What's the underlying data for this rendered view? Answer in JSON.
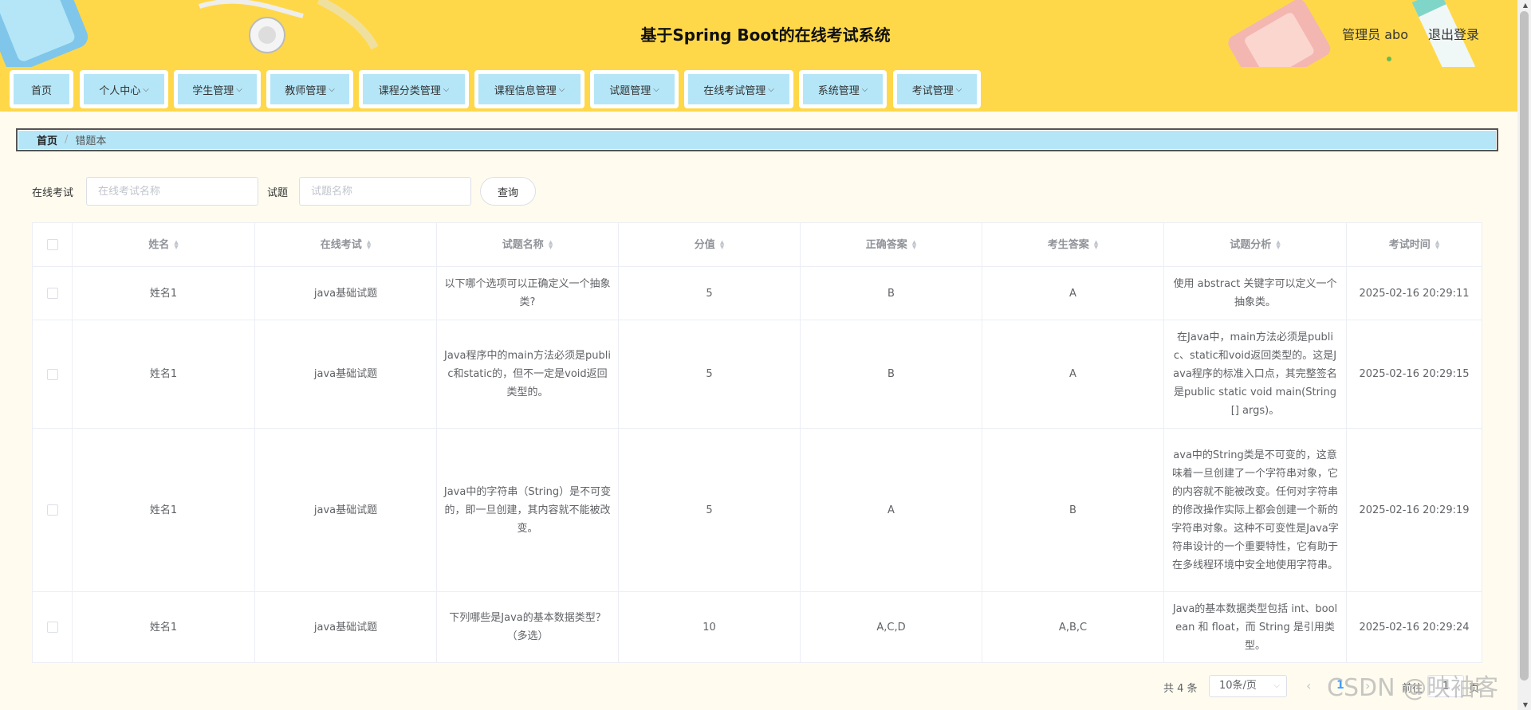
{
  "header": {
    "title": "基于Spring Boot的在线考试系统",
    "user": "管理员 abo",
    "logout": "退出登录"
  },
  "nav": {
    "items": [
      {
        "label": "首页",
        "dropdown": false
      },
      {
        "label": "个人中心",
        "dropdown": true
      },
      {
        "label": "学生管理",
        "dropdown": true
      },
      {
        "label": "教师管理",
        "dropdown": true
      },
      {
        "label": "课程分类管理",
        "dropdown": true
      },
      {
        "label": "课程信息管理",
        "dropdown": true
      },
      {
        "label": "试题管理",
        "dropdown": true
      },
      {
        "label": "在线考试管理",
        "dropdown": true
      },
      {
        "label": "系统管理",
        "dropdown": true
      },
      {
        "label": "考试管理",
        "dropdown": true
      }
    ]
  },
  "breadcrumb": {
    "home": "首页",
    "separator": "/",
    "current": "错题本"
  },
  "search": {
    "exam_label": "在线考试",
    "exam_placeholder": "在线考试名称",
    "question_label": "试题",
    "question_placeholder": "试题名称",
    "button": "查询"
  },
  "table": {
    "columns": [
      "姓名",
      "在线考试",
      "试题名称",
      "分值",
      "正确答案",
      "考生答案",
      "试题分析",
      "考试时间"
    ],
    "rows": [
      {
        "name": "姓名1",
        "exam": "java基础试题",
        "question": "以下哪个选项可以正确定义一个抽象类?",
        "score": "5",
        "correct": "B",
        "answer": "A",
        "analysis": "使用 abstract 关键字可以定义一个抽象类。",
        "time": "2025-02-16 20:29:11"
      },
      {
        "name": "姓名1",
        "exam": "java基础试题",
        "question": "Java程序中的main方法必须是public和static的，但不一定是void返回类型的。",
        "score": "5",
        "correct": "B",
        "answer": "A",
        "analysis": "在Java中，main方法必须是public、static和void返回类型的。这是Java程序的标准入口点，其完整签名是public static void main(String[] args)。",
        "time": "2025-02-16 20:29:15"
      },
      {
        "name": "姓名1",
        "exam": "java基础试题",
        "question": "Java中的字符串（String）是不可变的，即一旦创建，其内容就不能被改变。",
        "score": "5",
        "correct": "A",
        "answer": "B",
        "analysis": "ava中的String类是不可变的，这意味着一旦创建了一个字符串对象，它的内容就不能被改变。任何对字符串的修改操作实际上都会创建一个新的字符串对象。这种不可变性是Java字符串设计的一个重要特性，它有助于在多线程环境中安全地使用字符串。",
        "time": "2025-02-16 20:29:19"
      },
      {
        "name": "姓名1",
        "exam": "java基础试题",
        "question": "下列哪些是Java的基本数据类型？（多选）",
        "score": "10",
        "correct": "A,C,D",
        "answer": "A,B,C",
        "analysis": "Java的基本数据类型包括 int、boolean 和 float，而 String 是引用类型。",
        "time": "2025-02-16 20:29:24"
      }
    ]
  },
  "pagination": {
    "total": "共 4 条",
    "page_size": "10条/页",
    "current_page": "1",
    "goto_label": "前往",
    "goto_value": "1",
    "page_suffix": "页"
  },
  "watermark": "CSDN @映袖客",
  "icons": {
    "sort": "sort-caret-icon",
    "chevron": "chevron-down-icon",
    "prev": "chevron-left-icon",
    "next": "chevron-right-icon"
  },
  "colors": {
    "header_bg": "#ffd84a",
    "nav_item_bg": "#b5e6f7",
    "page_bg": "#fffcef",
    "active_page": "#409eff"
  }
}
